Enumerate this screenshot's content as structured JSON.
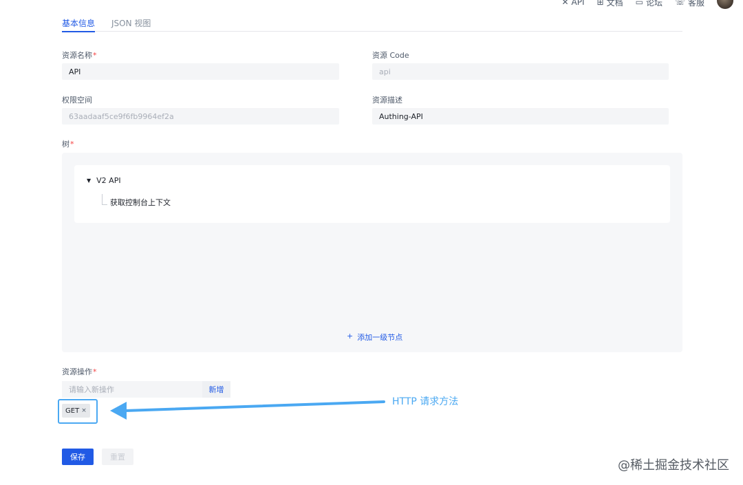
{
  "topnav": {
    "items": [
      {
        "icon": "close-x-icon",
        "label": "API"
      },
      {
        "icon": "doc-icon",
        "label": "文档"
      },
      {
        "icon": "forum-icon",
        "label": "论坛"
      },
      {
        "icon": "support-icon",
        "label": "客服"
      }
    ]
  },
  "tabs": [
    {
      "label": "基本信息",
      "active": true
    },
    {
      "label": "JSON 视图",
      "active": false
    }
  ],
  "form": {
    "resource_name": {
      "label": "资源名称",
      "required": "*",
      "value": "API"
    },
    "resource_code": {
      "label": "资源 Code",
      "value": "api"
    },
    "namespace": {
      "label": "权限空间",
      "value": "63aadaaf5ce9f6fb9964ef2a"
    },
    "description": {
      "label": "资源描述",
      "value": "Authing-API"
    },
    "tree": {
      "label": "树",
      "required": "*",
      "root": {
        "label": "V2 API",
        "caret": "▼"
      },
      "child": {
        "label": "获取控制台上下文"
      },
      "add_root_icon": "+",
      "add_root_label": "添加一级节点"
    },
    "actions": {
      "label": "资源操作",
      "required": "*",
      "input_placeholder": "请输入新操作",
      "add_button": "新增",
      "tags": [
        {
          "label": "GET",
          "close": "×"
        }
      ]
    }
  },
  "annotation": {
    "text": "HTTP 请求方法",
    "color": "#4aa8f2"
  },
  "footer": {
    "save": "保存",
    "reset": "重置"
  },
  "watermark": "@稀土掘金技术社区",
  "colors": {
    "primary": "#215ae5",
    "required": "#f53f3f",
    "annotation": "#4aa8f2"
  }
}
